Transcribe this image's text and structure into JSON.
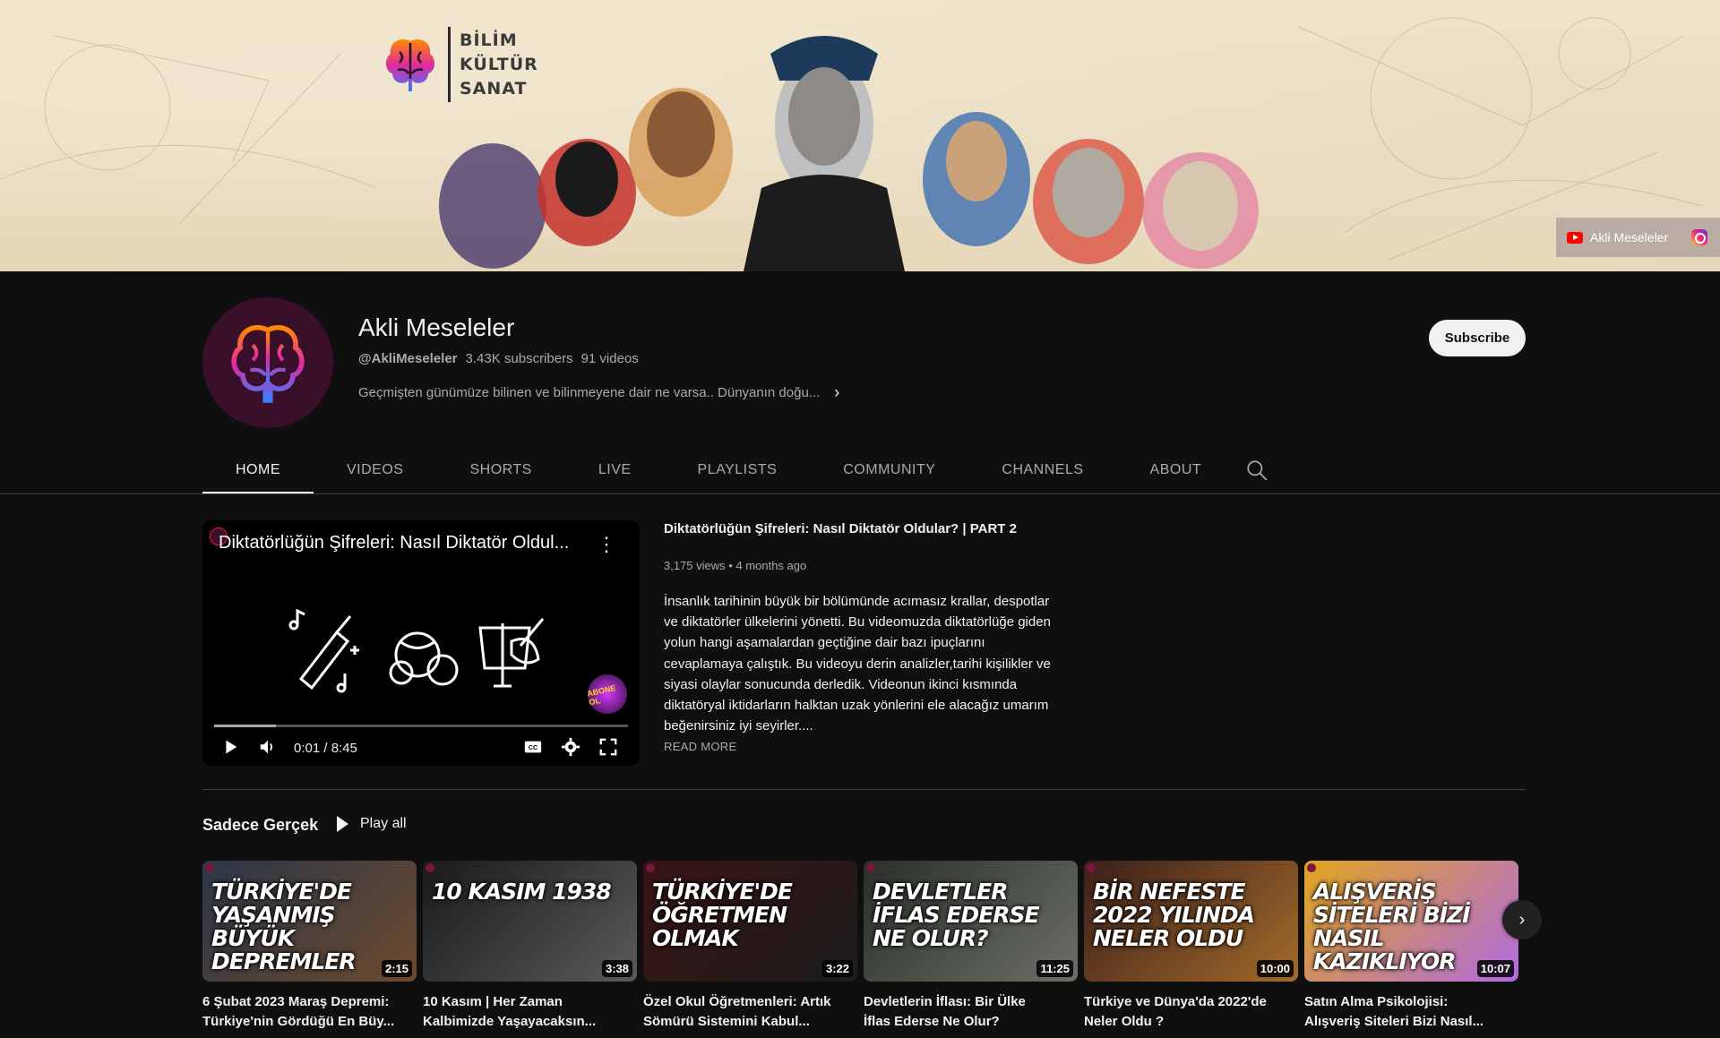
{
  "banner": {
    "brand_words": [
      "BİLİM",
      "KÜLTÜR",
      "SANAT"
    ],
    "social_link_label": "Akli Meseleler"
  },
  "channel": {
    "name": "Akli Meseleler",
    "handle": "@AkliMeseleler",
    "subscribers": "3.43K subscribers",
    "videos": "91 videos",
    "description": "Geçmişten günümüze bilinen ve bilinmeyene dair ne varsa.. Dünyanın doğu...",
    "subscribe_label": "Subscribe"
  },
  "tabs": [
    {
      "label": "HOME",
      "active": true
    },
    {
      "label": "VIDEOS"
    },
    {
      "label": "SHORTS"
    },
    {
      "label": "LIVE"
    },
    {
      "label": "PLAYLISTS"
    },
    {
      "label": "COMMUNITY"
    },
    {
      "label": "CHANNELS"
    },
    {
      "label": "ABOUT"
    }
  ],
  "featured": {
    "player_title": "Diktatörlüğün Şifreleri: Nasıl Diktatör Oldul...",
    "player_badge": "ABONE OL",
    "time": "0:01 / 8:45",
    "progress_fraction": 0.15,
    "title": "Diktatörlüğün Şifreleri: Nasıl Diktatör Oldular?  | PART 2",
    "views": "3,175 views",
    "age": "4 months ago",
    "description": "İnsanlık tarihinin büyük bir bölümünde acımasız krallar, despotlar ve diktatörler ülkelerini yönetti. Bu videomuzda diktatörlüğe giden yolun hangi aşamalardan geçtiğine dair bazı ipuçlarını cevaplamaya çalıştık. Bu videoyu derin analizler,tarihi kişilikler ve siyasi olaylar sonucunda derledik. Videonun ikinci kısmında diktatöryal iktidarların halktan uzak yönlerini ele alacağız umarım beğenirsiniz iyi seyirler....",
    "read_more": "READ MORE"
  },
  "shelf": {
    "title": "Sadece Gerçek",
    "play_all": "Play all",
    "items": [
      {
        "thumb_text": "TÜRKİYE'DE\nYAŞANMIŞ BÜYÜK\nDEPREMLER",
        "duration": "2:15",
        "title": "6 Şubat 2023 Maraş Depremi:",
        "title2": "Türkiye'nin Gördüğü En Büy...",
        "colors": [
          "#2b3648",
          "#6d4a2e"
        ]
      },
      {
        "thumb_text": "10 KASIM 1938",
        "duration": "3:38",
        "title": "10 Kasım | Her Zaman",
        "title2": "Kalbimizde Yaşayacaksın...",
        "colors": [
          "#1a1a1a",
          "#5a5a5a"
        ]
      },
      {
        "thumb_text": "TÜRKİYE'DE\nÖĞRETMEN\nOLMAK",
        "duration": "3:22",
        "title": "Özel Okul Öğretmenleri: Artık",
        "title2": "Sömürü Sistemini Kabul...",
        "colors": [
          "#3a1414",
          "#1c1c1c"
        ]
      },
      {
        "thumb_text": "DEVLETLER\nİFLAS EDERSE\nNE OLUR?",
        "duration": "11:25",
        "title": "Devletlerin İflası: Bir Ülke",
        "title2": "İflas Ederse Ne Olur?",
        "colors": [
          "#2a2f2a",
          "#6b6f66"
        ]
      },
      {
        "thumb_text": "BİR NEFESTE\n2022 YILINDA\nNELER OLDU",
        "duration": "10:00",
        "title": "Türkiye ve Dünya'da 2022'de",
        "title2": "Neler Oldu ?",
        "colors": [
          "#3b1f1b",
          "#a36a2a"
        ]
      },
      {
        "thumb_text": "ALIŞVERİŞ\nSİTELERİ BİZİ\nNASIL\nKAZIKLIYOR",
        "duration": "10:07",
        "title": "Satın Alma Psikolojisi:",
        "title2": "Alışveriş Siteleri Bizi Nasıl...",
        "colors": [
          "#e2a51e",
          "#b16ae0"
        ]
      }
    ]
  }
}
